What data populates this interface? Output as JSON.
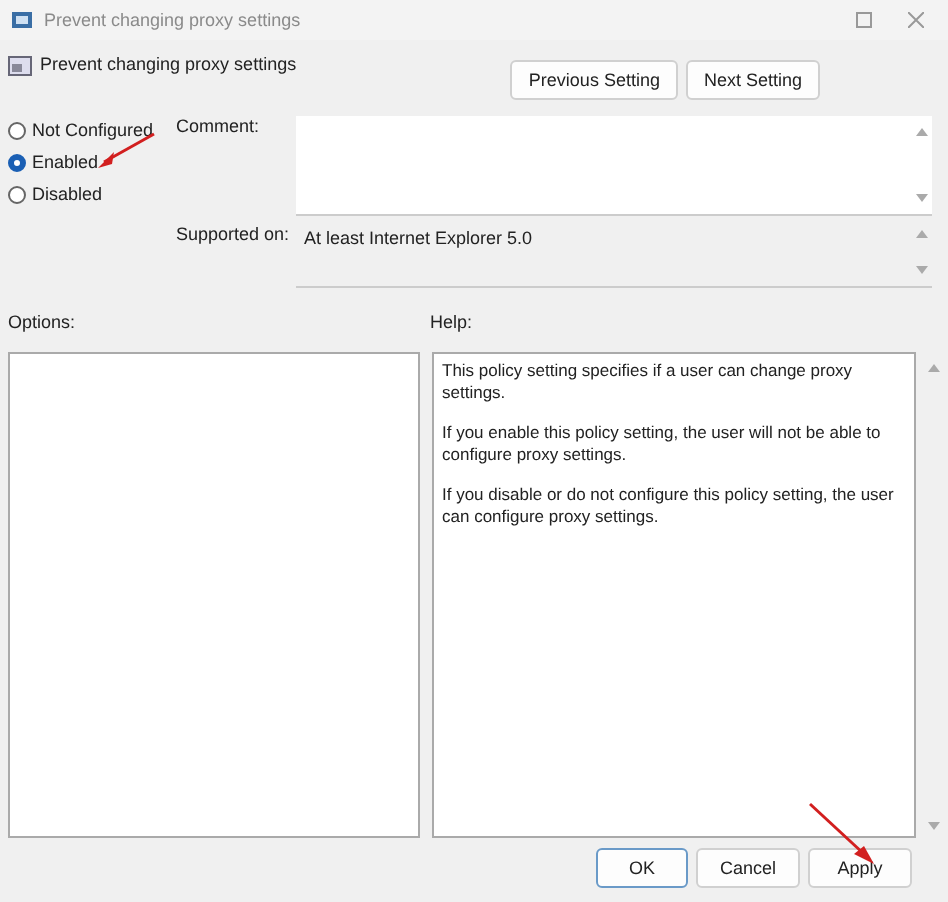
{
  "window": {
    "title": "Prevent changing proxy settings"
  },
  "heading": "Prevent changing proxy settings",
  "nav_buttons": [
    "Previous Setting",
    "Next Setting"
  ],
  "states": [
    {
      "label": "Not Configured",
      "selected": false
    },
    {
      "label": "Enabled",
      "selected": true
    },
    {
      "label": "Disabled",
      "selected": false
    }
  ],
  "comment": {
    "label": "Comment:"
  },
  "supported_on": {
    "label": "Supported on:",
    "value": "At least Internet Explorer 5.0"
  },
  "options": {
    "label": "Options:"
  },
  "help": {
    "label": "Help:",
    "paragraphs": [
      "This policy setting specifies if a user can change proxy settings.",
      "If you enable this policy setting, the user will not be able to configure proxy settings.",
      "If you disable or do not configure this policy setting, the user can configure proxy settings."
    ]
  },
  "buttons": [
    {
      "label": "OK",
      "default": true
    },
    {
      "label": "Cancel",
      "default": false
    },
    {
      "label": "Apply",
      "default": false
    }
  ]
}
